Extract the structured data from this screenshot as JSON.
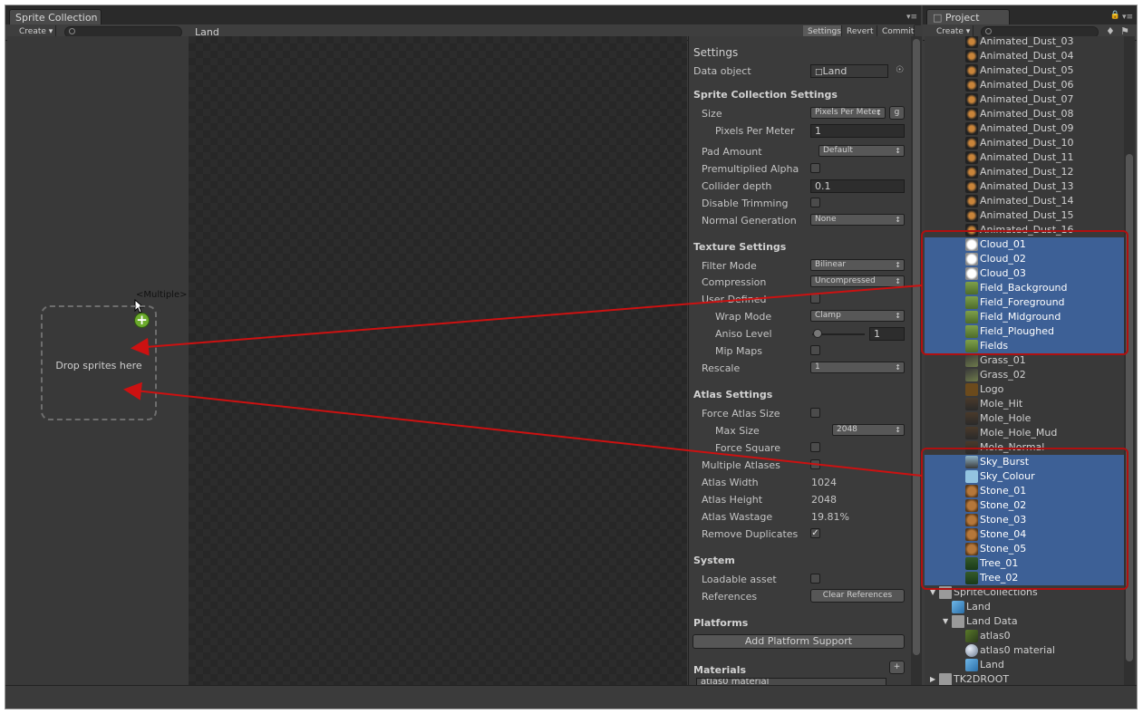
{
  "left_window": {
    "tab_title": "Sprite Collection",
    "toolbar": {
      "create_label": "Create",
      "collection_name": "Land",
      "settings_label": "Settings",
      "revert_label": "Revert",
      "commit_label": "Commit"
    },
    "drop_area": {
      "text": "Drop sprites here",
      "multiple_label": "<Multiple>"
    }
  },
  "inspector": {
    "title": "Settings",
    "data_object": {
      "label": "Data object",
      "value": "Land"
    },
    "sprite_collection_settings": {
      "header": "Sprite Collection Settings",
      "size_label": "Size",
      "size_value": "Pixels Per Meter",
      "size_button": "g",
      "ppm_label": "Pixels Per Meter",
      "ppm_value": "1",
      "pad_label": "Pad Amount",
      "pad_value": "Default",
      "premult_label": "Premultiplied Alpha",
      "collider_label": "Collider depth",
      "collider_value": "0.1",
      "trim_label": "Disable Trimming",
      "normal_label": "Normal Generation",
      "normal_value": "None"
    },
    "texture_settings": {
      "header": "Texture Settings",
      "filter_label": "Filter Mode",
      "filter_value": "Bilinear",
      "compression_label": "Compression",
      "compression_value": "Uncompressed",
      "user_defined_label": "User Defined",
      "wrap_label": "Wrap Mode",
      "wrap_value": "Clamp",
      "aniso_label": "Aniso Level",
      "aniso_value": "1",
      "mip_label": "Mip Maps",
      "rescale_label": "Rescale",
      "rescale_value": "1"
    },
    "atlas_settings": {
      "header": "Atlas Settings",
      "force_size_label": "Force Atlas Size",
      "max_size_label": "Max Size",
      "max_size_value": "2048",
      "force_square_label": "Force Square",
      "multiple_label": "Multiple Atlases",
      "width_label": "Atlas Width",
      "width_value": "1024",
      "height_label": "Atlas Height",
      "height_value": "2048",
      "wastage_label": "Atlas Wastage",
      "wastage_value": "19.81%",
      "remove_dup_label": "Remove Duplicates",
      "remove_dup_checked": true
    },
    "system": {
      "header": "System",
      "loadable_label": "Loadable asset",
      "references_label": "References",
      "clear_button": "Clear References"
    },
    "platforms": {
      "header": "Platforms",
      "add_button": "Add Platform Support"
    },
    "materials": {
      "header": "Materials",
      "add_button": "+",
      "item": "atlas0 material"
    }
  },
  "project": {
    "tab_title": "Project",
    "create_label": "Create",
    "items": [
      {
        "label": "Animated_Dust_03",
        "icon": "dust-icon"
      },
      {
        "label": "Animated_Dust_04",
        "icon": "dust-icon"
      },
      {
        "label": "Animated_Dust_05",
        "icon": "dust-icon"
      },
      {
        "label": "Animated_Dust_06",
        "icon": "dust-icon"
      },
      {
        "label": "Animated_Dust_07",
        "icon": "dust-icon"
      },
      {
        "label": "Animated_Dust_08",
        "icon": "dust-icon"
      },
      {
        "label": "Animated_Dust_09",
        "icon": "dust-icon"
      },
      {
        "label": "Animated_Dust_10",
        "icon": "dust-icon"
      },
      {
        "label": "Animated_Dust_11",
        "icon": "dust-icon"
      },
      {
        "label": "Animated_Dust_12",
        "icon": "dust-icon"
      },
      {
        "label": "Animated_Dust_13",
        "icon": "dust-icon"
      },
      {
        "label": "Animated_Dust_14",
        "icon": "dust-icon"
      },
      {
        "label": "Animated_Dust_15",
        "icon": "dust-icon"
      },
      {
        "label": "Animated_Dust_16",
        "icon": "dust-icon"
      },
      {
        "label": "Cloud_01",
        "icon": "cloud-icon",
        "selected": true
      },
      {
        "label": "Cloud_02",
        "icon": "cloud-icon",
        "selected": true
      },
      {
        "label": "Cloud_03",
        "icon": "cloud-icon",
        "selected": true
      },
      {
        "label": "Field_Background",
        "icon": "field-icon",
        "selected": true
      },
      {
        "label": "Field_Foreground",
        "icon": "field-icon",
        "selected": true
      },
      {
        "label": "Field_Midground",
        "icon": "field-icon",
        "selected": true
      },
      {
        "label": "Field_Ploughed",
        "icon": "field-icon",
        "selected": true
      },
      {
        "label": "Fields",
        "icon": "field-icon",
        "selected": true
      },
      {
        "label": "Grass_01",
        "icon": "grass-icon"
      },
      {
        "label": "Grass_02",
        "icon": "grass-icon"
      },
      {
        "label": "Logo",
        "icon": "logo-icon"
      },
      {
        "label": "Mole_Hit",
        "icon": "mole-icon"
      },
      {
        "label": "Mole_Hole",
        "icon": "mole-icon"
      },
      {
        "label": "Mole_Hole_Mud",
        "icon": "mole-icon"
      },
      {
        "label": "Mole_Normal",
        "icon": "mole-icon"
      },
      {
        "label": "Sky_Burst",
        "icon": "sky-icon",
        "selected": true
      },
      {
        "label": "Sky_Colour",
        "icon": "sky-colour-icon",
        "selected": true
      },
      {
        "label": "Stone_01",
        "icon": "stone-icon",
        "selected": true
      },
      {
        "label": "Stone_02",
        "icon": "stone-icon",
        "selected": true
      },
      {
        "label": "Stone_03",
        "icon": "stone-icon",
        "selected": true
      },
      {
        "label": "Stone_04",
        "icon": "stone-icon",
        "selected": true
      },
      {
        "label": "Stone_05",
        "icon": "stone-icon",
        "selected": true
      },
      {
        "label": "Tree_01",
        "icon": "tree-icon",
        "selected": true
      },
      {
        "label": "Tree_02",
        "icon": "tree-icon",
        "selected": true
      },
      {
        "label": "SpriteCollections",
        "icon": "folder-icon",
        "expanded": true
      },
      {
        "label": "Land",
        "icon": "prefab-icon"
      },
      {
        "label": "Land Data",
        "icon": "folder-icon",
        "expanded": true
      },
      {
        "label": "atlas0",
        "icon": "texture-icon"
      },
      {
        "label": "atlas0 material",
        "icon": "material-icon"
      },
      {
        "label": "Land",
        "icon": "prefab-icon"
      },
      {
        "label": "TK2DROOT",
        "icon": "folder-icon",
        "expanded": false
      }
    ]
  },
  "colors": {
    "selection": "#3d6096",
    "arrow": "#cc1111",
    "panel": "#393939"
  }
}
